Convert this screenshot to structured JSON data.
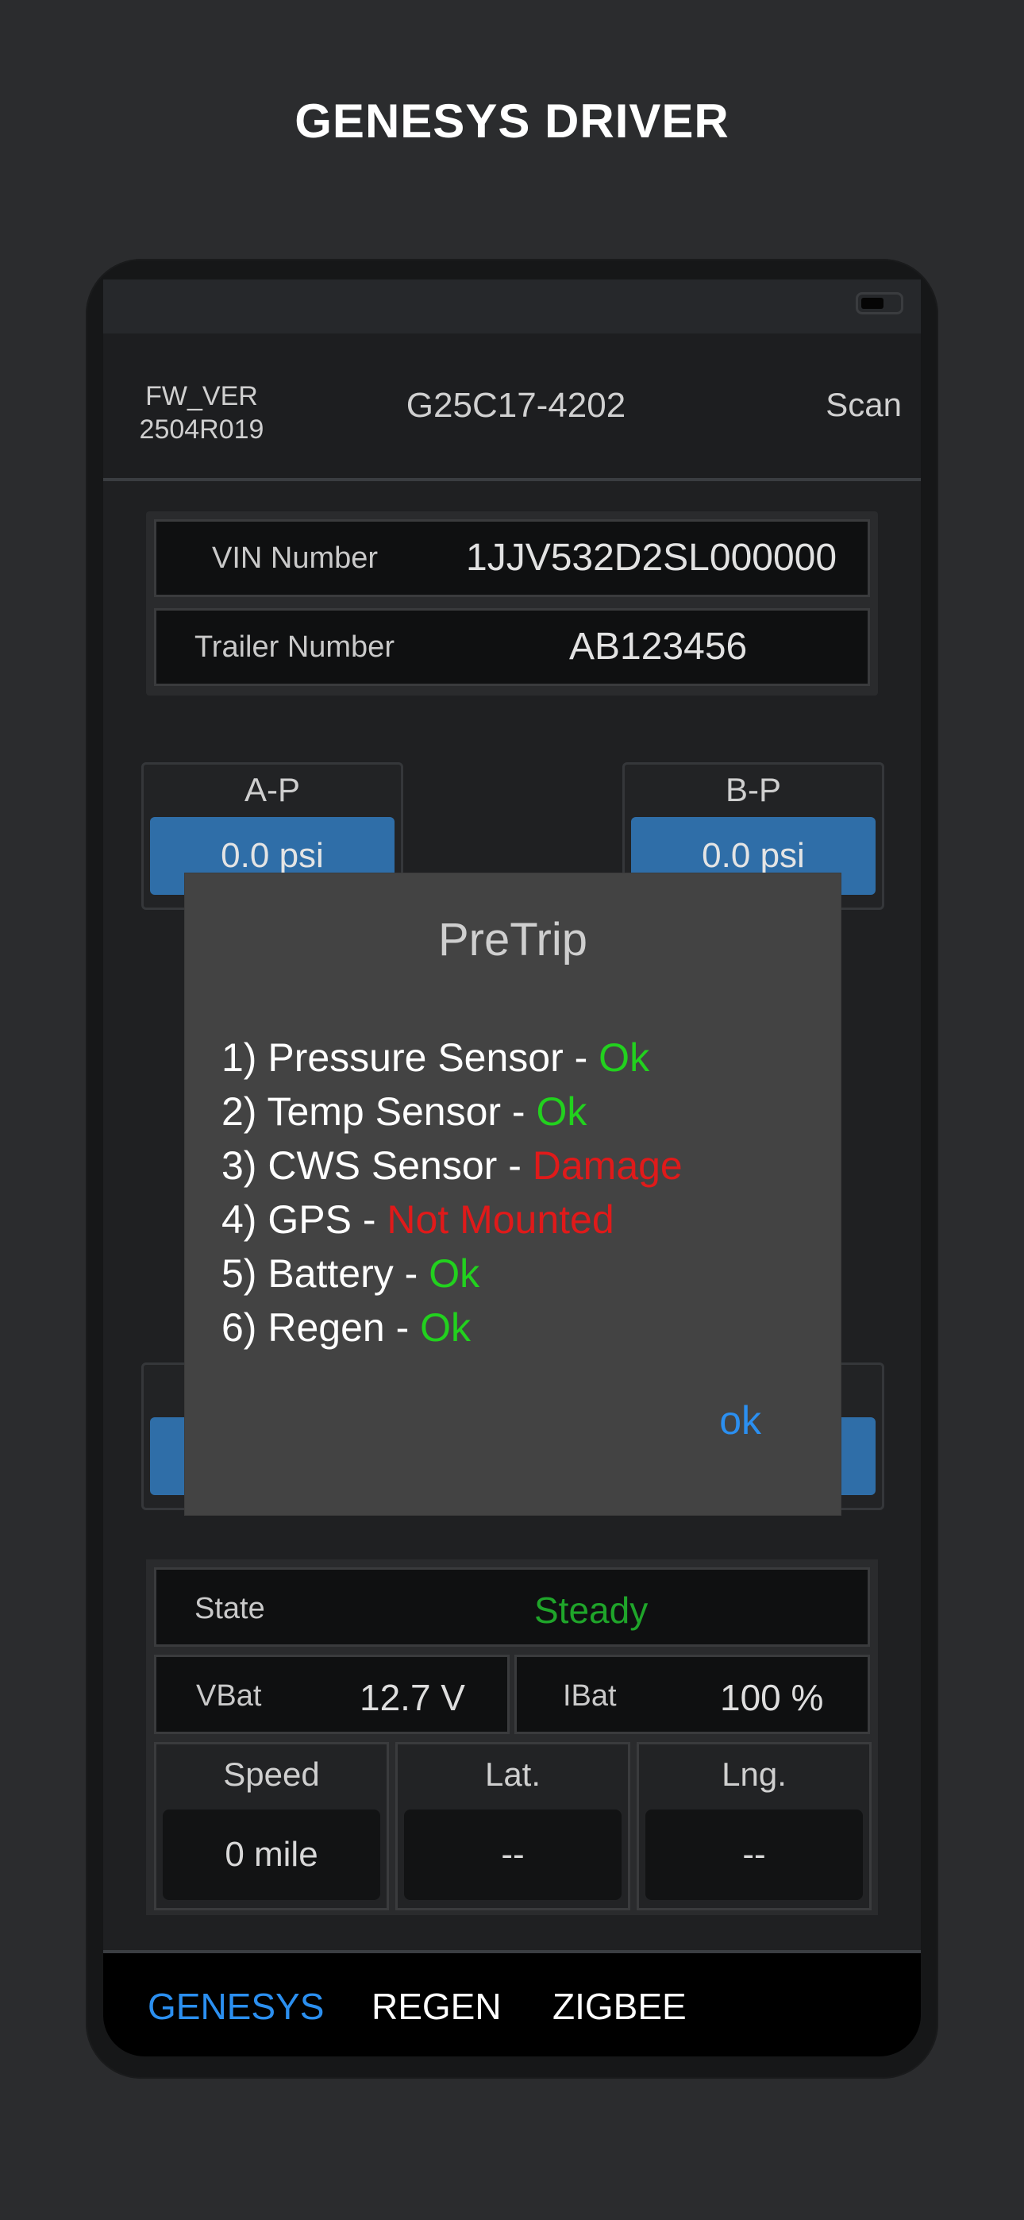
{
  "page": {
    "title": "GENESYS DRIVER"
  },
  "header": {
    "fw_label": "FW_VER",
    "fw_value": "2504R019",
    "device_id": "G25C17-4202",
    "scan_label": "Scan"
  },
  "info": {
    "vin_label": "VIN Number",
    "vin_value": "1JJV532D2SL000000",
    "trailer_label": "Trailer Number",
    "trailer_value": "AB123456"
  },
  "tires": [
    {
      "name": "A-P",
      "value": "0.0 psi"
    },
    {
      "name": "B-P",
      "value": "0.0 psi"
    }
  ],
  "dialog": {
    "title": "PreTrip",
    "items": [
      {
        "label": "1) Pressure Sensor - ",
        "status": "Ok"
      },
      {
        "label": "2) Temp Sensor - ",
        "status": "Ok"
      },
      {
        "label": "3) CWS Sensor - ",
        "status": "Damage"
      },
      {
        "label": "4) GPS - ",
        "status": "Not Mounted"
      },
      {
        "label": "5) Battery - ",
        "status": "Ok"
      },
      {
        "label": "6) Regen - ",
        "status": "Ok"
      }
    ],
    "ok_label": "ok"
  },
  "status": {
    "state_label": "State",
    "state_value": "Steady",
    "vbat_label": "VBat",
    "vbat_value": "12.7 V",
    "ibat_label": "IBat",
    "ibat_value": "100 %",
    "speed_label": "Speed",
    "speed_value": "0 mile",
    "lat_label": "Lat.",
    "lat_value": "--",
    "lng_label": "Lng.",
    "lng_value": "--"
  },
  "nav": {
    "tabs": [
      "GENESYS",
      "REGEN",
      "ZIGBEE"
    ],
    "active": "GENESYS"
  },
  "colors": {
    "ok": "#22d11e",
    "bad": "#e01a1a",
    "accent": "#2b8ff0",
    "state": "#1fa52a"
  }
}
